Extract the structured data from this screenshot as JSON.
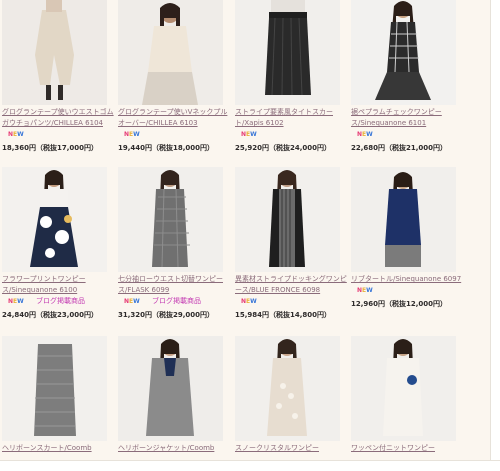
{
  "colors": {
    "background": "#fbf6ef",
    "link": "#8b6c7b",
    "blog": "#c339b2"
  },
  "badges": {
    "new_n": "N",
    "new_e": "E",
    "new_w": "W"
  },
  "products": [
    {
      "name": "グログランテープ使いウエストゴムガウチョパンツ/CHILLEA 6104",
      "new": true,
      "blog_text": "",
      "price": "18,360円（税抜17,000円）"
    },
    {
      "name": "グログランテープ使いVネックプルオーバー/CHILLEA 6103",
      "new": true,
      "blog_text": "",
      "price": "19,440円（税抜18,000円）"
    },
    {
      "name": "ストライプ要素風タイトスカート/Xapis 6102",
      "new": true,
      "blog_text": "",
      "price": "25,920円（税抜24,000円）"
    },
    {
      "name": "裾ペプラムチェックワンピース/Sinequanone 6101",
      "new": true,
      "blog_text": "",
      "price": "22,680円（税抜21,000円）"
    },
    {
      "name": "フラワープリントワンピース/Sinequanone 6100",
      "new": true,
      "blog_text": "ブログ掲載商品",
      "price": "24,840円（税抜23,000円）"
    },
    {
      "name": "七分袖ローウエスト切替ワンピース/FLASK 6099",
      "new": true,
      "blog_text": "ブログ掲載商品",
      "price": "31,320円（税抜29,000円）"
    },
    {
      "name": "異素材ストライプドッキングワンピース/BLUE FRONCE 6098",
      "new": true,
      "blog_text": "",
      "price": "15,984円（税抜14,800円）"
    },
    {
      "name": "リブタートル/Sinequanone 6097",
      "new": true,
      "blog_text": "",
      "price": "12,960円（税抜12,000円）"
    },
    {
      "name": "ヘリボーンスカート/Coomb",
      "new": false,
      "blog_text": "",
      "price": ""
    },
    {
      "name": "ヘリボーンジャケット/Coomb",
      "new": false,
      "blog_text": "",
      "price": ""
    },
    {
      "name": "スノークリスタルワンピー",
      "new": false,
      "blog_text": "",
      "price": ""
    },
    {
      "name": "ワッペン付ニットワンピー",
      "new": false,
      "blog_text": "",
      "price": ""
    }
  ]
}
